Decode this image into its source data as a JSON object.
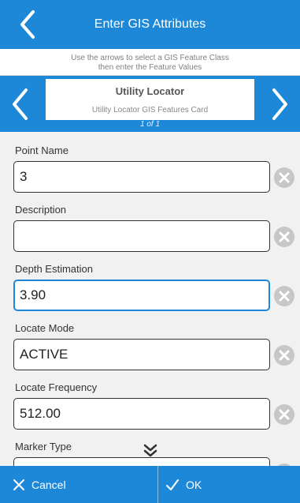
{
  "header": {
    "title": "Enter GIS Attributes",
    "back_icon": "chevron-left-icon"
  },
  "instructions": {
    "line1": "Use the arrows to select a GIS Feature Class",
    "line2": "then enter the Feature Values"
  },
  "feature_card": {
    "title": "Utility Locator",
    "subtitle": "Utility Locator GIS Features Card",
    "counter": "1 of 1"
  },
  "fields": [
    {
      "label": "Point Name",
      "value": "3"
    },
    {
      "label": "Description",
      "value": ""
    },
    {
      "label": "Depth Estimation",
      "value": "3.90"
    },
    {
      "label": "Locate Mode",
      "value": "ACTIVE"
    },
    {
      "label": "Locate Frequency",
      "value": "512.00"
    },
    {
      "label": "Marker Type",
      "value": ""
    }
  ],
  "footer": {
    "cancel_label": "Cancel",
    "ok_label": "OK"
  },
  "colors": {
    "brand_blue": "#1e88d8",
    "clear_grey": "#c7c7c7"
  }
}
